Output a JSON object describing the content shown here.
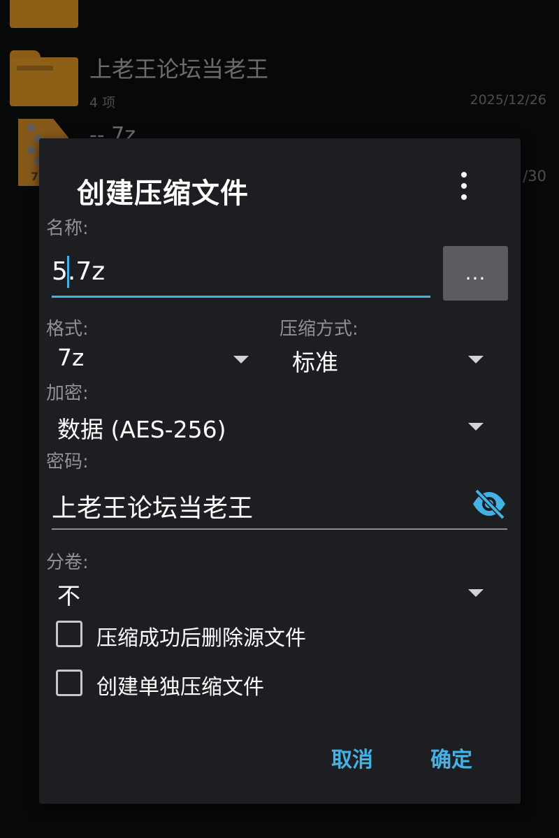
{
  "background_list": {
    "folder": {
      "name": "上老王论坛当老王",
      "count": "4 项",
      "date": "2025/12/26"
    },
    "archive": {
      "name": "-- 7z",
      "badge": "7",
      "date_partial": "/30"
    }
  },
  "dialog": {
    "title": "创建压缩文件",
    "menu_icon": "more-vert-icon",
    "name_label": "名称:",
    "name_value": "5.7z",
    "browse_label": "...",
    "format_label": "格式:",
    "format_value": "7z",
    "method_label": "压缩方式:",
    "method_value": "标准",
    "encryption_label": "加密:",
    "encryption_value": "数据 (AES-256)",
    "password_label": "密码:",
    "password_value": "上老王论坛当老王",
    "password_toggle_icon": "visibility-off-icon",
    "split_label": "分卷:",
    "split_value": "不",
    "checkbox_delete_source": {
      "label": "压缩成功后删除源文件",
      "checked": false
    },
    "checkbox_separate": {
      "label": "创建单独压缩文件",
      "checked": false
    },
    "cancel_label": "取消",
    "ok_label": "确定"
  },
  "colors": {
    "accent": "#45b2e6",
    "dialog_bg": "#1c1e21",
    "label_gray": "#8f9193",
    "folder": "#8e5f17"
  }
}
